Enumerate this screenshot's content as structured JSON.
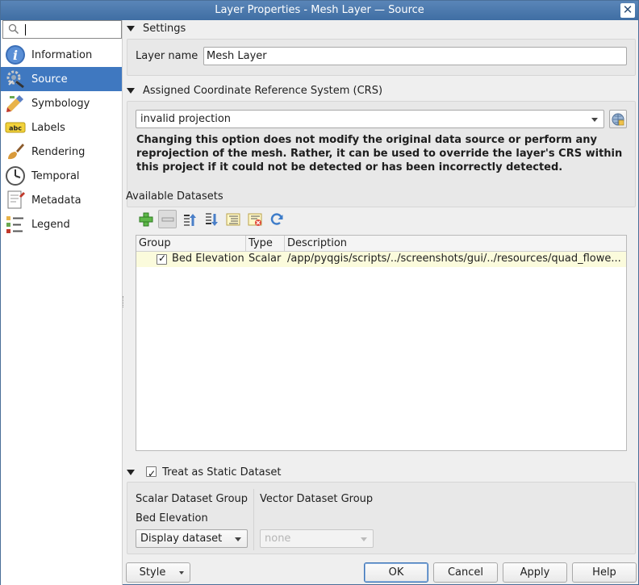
{
  "window": {
    "title": "Layer Properties - Mesh Layer — Source",
    "close_glyph": "✕"
  },
  "search": {
    "value": "",
    "icon": "search-icon"
  },
  "sidebar": {
    "items": [
      {
        "label": "Information",
        "icon": "information-icon"
      },
      {
        "label": "Source",
        "icon": "source-icon",
        "active": true
      },
      {
        "label": "Symbology",
        "icon": "symbology-icon"
      },
      {
        "label": "Labels",
        "icon": "labels-icon"
      },
      {
        "label": "Rendering",
        "icon": "rendering-icon"
      },
      {
        "label": "Temporal",
        "icon": "temporal-icon"
      },
      {
        "label": "Metadata",
        "icon": "metadata-icon"
      },
      {
        "label": "Legend",
        "icon": "legend-icon"
      }
    ]
  },
  "settings": {
    "heading": "Settings",
    "layer_name_label": "Layer name",
    "layer_name_value": "Mesh Layer"
  },
  "crs": {
    "heading": "Assigned Coordinate Reference System (CRS)",
    "selected": "invalid projection",
    "warning_line1": "Changing this option does not modify the original data source or perform any",
    "warning_line2": "reprojection of the mesh. Rather, it can be used to override the layer's CRS within",
    "warning_line3": "this project if it could not be detected or has been incorrectly detected."
  },
  "datasets": {
    "heading": "Available Datasets",
    "toolbar": [
      "add-dataset-icon",
      "remove-dataset-icon",
      "move-up-icon",
      "move-down-icon",
      "expand-all-icon",
      "collapse-all-icon",
      "reload-icon"
    ],
    "columns": {
      "group": "Group",
      "type": "Type",
      "description": "Description"
    },
    "rows": [
      {
        "group": "Bed Elevation",
        "type": "Scalar",
        "description": "/app/pyqgis/scripts/../screenshots/gui/../resources/quad_flowe...",
        "checked": true
      }
    ]
  },
  "static_dataset": {
    "heading": "Treat as Static Dataset",
    "checked": true,
    "scalar_label": "Scalar Dataset Group",
    "scalar_group": "Bed Elevation",
    "scalar_combo": "Display dataset",
    "vector_label": "Vector Dataset Group",
    "vector_combo": "none"
  },
  "footer": {
    "style": "Style",
    "ok": "OK",
    "cancel": "Cancel",
    "apply": "Apply",
    "help": "Help"
  },
  "colors": {
    "accent": "#3f78c0",
    "titlebar": "#4a79ae",
    "row_highlight": "#fbfbdc"
  }
}
